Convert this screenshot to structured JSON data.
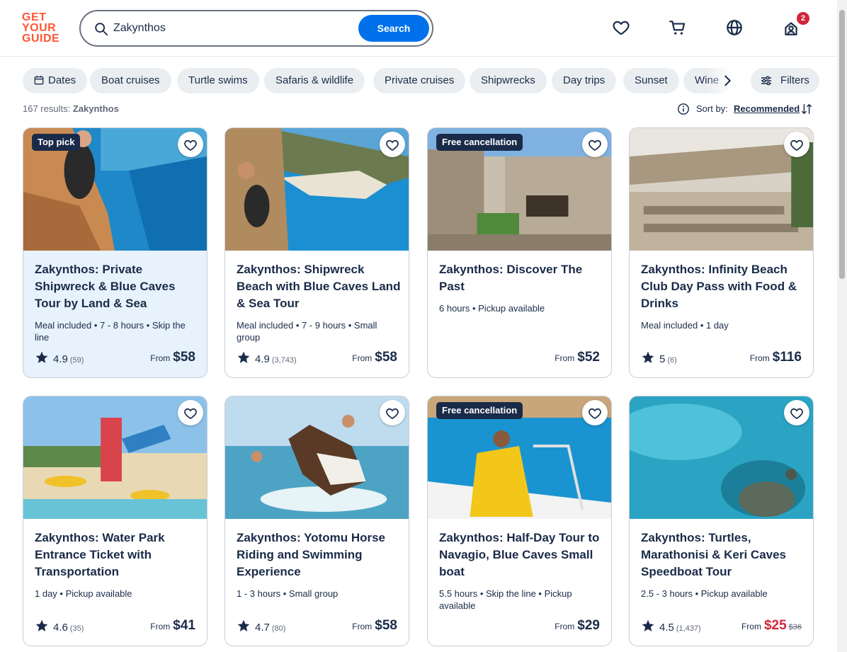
{
  "logo": {
    "line1": "GET",
    "line2": "YOUR",
    "line3": "GUIDE",
    "color": "#ff5533"
  },
  "search": {
    "value": "Zakynthos",
    "button": "Search"
  },
  "header_icons": [
    "heart-icon",
    "cart-icon",
    "globe-icon",
    "profile-icon"
  ],
  "notifications": {
    "count": "2"
  },
  "chips": [
    {
      "label": "Dates",
      "icon": "calendar-icon"
    },
    {
      "label": "Boat cruises"
    },
    {
      "label": "Turtle swims"
    },
    {
      "label": "Safaris & wildlife"
    },
    {
      "label": "Private cruises"
    },
    {
      "label": "Shipwrecks"
    },
    {
      "label": "Day trips"
    },
    {
      "label": "Sunset"
    },
    {
      "label": "Wine"
    }
  ],
  "filters_label": "Filters",
  "results": {
    "count": "167 results:",
    "query": "Zakynthos"
  },
  "sort": {
    "label": "Sort by:",
    "value": "Recommended"
  },
  "cards": [
    {
      "tag": "Top pick",
      "title": "Zakynthos: Private Shipwreck & Blue Caves Tour by Land & Sea",
      "meta": "Meal included • 7 - 8 hours • Skip the line",
      "rating": "4.9",
      "reviews": "(59)",
      "from": "From",
      "price": "$58",
      "old_price": ""
    },
    {
      "tag": "",
      "title": "Zakynthos: Shipwreck Beach with Blue Caves Land & Sea Tour",
      "meta": "Meal included • 7 - 9 hours • Small group",
      "rating": "4.9",
      "reviews": "(3,743)",
      "from": "From",
      "price": "$58",
      "old_price": ""
    },
    {
      "tag": "Free cancellation",
      "title": "Zakynthos: Discover The Past",
      "meta": "6 hours • Pickup available",
      "rating": "",
      "reviews": "",
      "from": "From",
      "price": "$52",
      "old_price": ""
    },
    {
      "tag": "",
      "title": "Zakynthos: Infinity Beach Club Day Pass with Food & Drinks",
      "meta": "Meal included • 1 day",
      "rating": "5",
      "reviews": "(6)",
      "from": "From",
      "price": "$116",
      "old_price": ""
    },
    {
      "tag": "",
      "title": "Zakynthos: Water Park Entrance Ticket with Transportation",
      "meta": "1 day • Pickup available",
      "rating": "4.6",
      "reviews": "(35)",
      "from": "From",
      "price": "$41",
      "old_price": ""
    },
    {
      "tag": "",
      "title": "Zakynthos: Yotomu Horse Riding and Swimming Experience",
      "meta": "1 - 3 hours • Small group",
      "rating": "4.7",
      "reviews": "(80)",
      "from": "From",
      "price": "$58",
      "old_price": ""
    },
    {
      "tag": "Free cancellation",
      "title": "Zakynthos: Half-Day Tour to Navagio, Blue Caves Small boat",
      "meta": "5.5 hours • Skip the line • Pickup available",
      "rating": "",
      "reviews": "",
      "from": "From",
      "price": "$29",
      "old_price": ""
    },
    {
      "tag": "",
      "title": "Zakynthos: Turtles, Marathonisi & Keri Caves Speedboat Tour",
      "meta": "2.5 - 3 hours • Pickup available",
      "rating": "4.5",
      "reviews": "(1,437)",
      "from": "From",
      "price": "$25",
      "old_price": "$36"
    }
  ],
  "colors": {
    "primary_button": "#0071eb",
    "text": "#1a2b49",
    "sale_price": "#d1263b",
    "selected_card": "#e8f2fd",
    "badge": "#d1263b"
  }
}
